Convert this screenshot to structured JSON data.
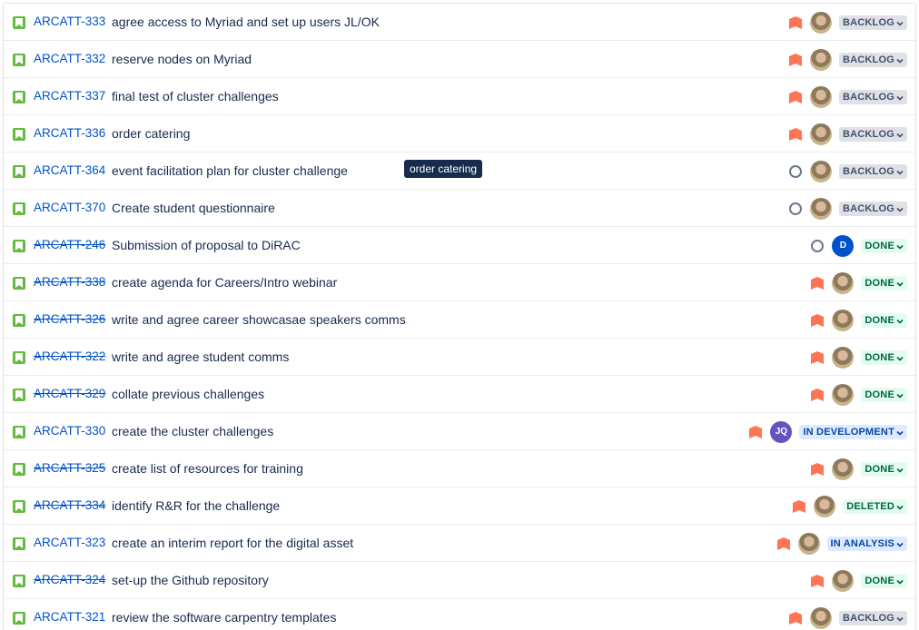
{
  "tooltip": "order catering",
  "colors": {
    "story_icon": "#63ba3c",
    "priority_high": "#ff7452",
    "link": "#0052cc",
    "avatar_d": "#0052cc",
    "avatar_jq": "#6554c0"
  },
  "rows": [
    {
      "key": "ARCATT-333",
      "summary": "agree access to Myriad and set up users JL/OK",
      "priority": "high",
      "assignee": "photo",
      "status": "BACKLOG",
      "resolved": false
    },
    {
      "key": "ARCATT-332",
      "summary": "reserve nodes on Myriad",
      "priority": "high",
      "assignee": "photo",
      "status": "BACKLOG",
      "resolved": false
    },
    {
      "key": "ARCATT-337",
      "summary": "final test of cluster challenges",
      "priority": "high",
      "assignee": "photo",
      "status": "BACKLOG",
      "resolved": false
    },
    {
      "key": "ARCATT-336",
      "summary": "order catering",
      "priority": "high",
      "assignee": "photo",
      "status": "BACKLOG",
      "resolved": false
    },
    {
      "key": "ARCATT-364",
      "summary": "event facilitation plan for cluster challenge",
      "priority": "medium",
      "assignee": "photo",
      "status": "BACKLOG",
      "resolved": false
    },
    {
      "key": "ARCATT-370",
      "summary": "Create student questionnaire",
      "priority": "medium",
      "assignee": "photo",
      "status": "BACKLOG",
      "resolved": false
    },
    {
      "key": "ARCATT-246",
      "summary": "Submission of proposal to DiRAC",
      "priority": "medium",
      "assignee": "D",
      "status": "DONE",
      "resolved": true
    },
    {
      "key": "ARCATT-338",
      "summary": "create agenda for Careers/Intro webinar",
      "priority": "high",
      "assignee": "photo",
      "status": "DONE",
      "resolved": true
    },
    {
      "key": "ARCATT-326",
      "summary": "write and agree career showcasae speakers comms",
      "priority": "high",
      "assignee": "photo",
      "status": "DONE",
      "resolved": true
    },
    {
      "key": "ARCATT-322",
      "summary": "write and agree student comms",
      "priority": "high",
      "assignee": "photo",
      "status": "DONE",
      "resolved": true
    },
    {
      "key": "ARCATT-329",
      "summary": "collate previous challenges",
      "priority": "high",
      "assignee": "photo",
      "status": "DONE",
      "resolved": true
    },
    {
      "key": "ARCATT-330",
      "summary": "create the cluster challenges",
      "priority": "high",
      "assignee": "JQ",
      "status": "IN DEVELOPMENT",
      "resolved": false
    },
    {
      "key": "ARCATT-325",
      "summary": "create list of resources for training",
      "priority": "high",
      "assignee": "photo",
      "status": "DONE",
      "resolved": true
    },
    {
      "key": "ARCATT-334",
      "summary": "identify R&R for the challenge",
      "priority": "high",
      "assignee": "photo",
      "status": "DELETED",
      "resolved": true
    },
    {
      "key": "ARCATT-323",
      "summary": "create an interim report for the digital asset",
      "priority": "high",
      "assignee": "photo",
      "status": "IN ANALYSIS",
      "resolved": false
    },
    {
      "key": "ARCATT-324",
      "summary": "set-up the Github repository",
      "priority": "high",
      "assignee": "photo",
      "status": "DONE",
      "resolved": true
    },
    {
      "key": "ARCATT-321",
      "summary": "review the software carpentry templates",
      "priority": "high",
      "assignee": "photo",
      "status": "BACKLOG",
      "resolved": false
    }
  ]
}
